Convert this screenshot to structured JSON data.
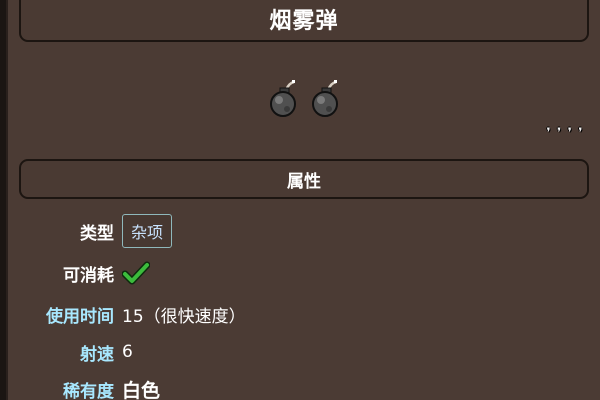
{
  "item": {
    "title": "烟雾弹",
    "count_glyph": "❜❜❜❜"
  },
  "section": {
    "title": "属性"
  },
  "attributes": {
    "type_label": "类型",
    "type_value": "杂项",
    "consumable_label": "可消耗",
    "use_time_label": "使用时间",
    "use_time_value": "15（很快速度）",
    "speed_label": "射速",
    "speed_value": "6",
    "rarity_label": "稀有度",
    "rarity_value": "白色"
  },
  "colors": {
    "panel_bg": "#4b3b34",
    "cyan_label": "#a8e8ff",
    "check_green": "#3cbc3c",
    "tag_border": "#8fb8bb"
  },
  "icons": {
    "item_sprite": "smoke-bomb-icon",
    "consumable": "checkmark-icon"
  }
}
